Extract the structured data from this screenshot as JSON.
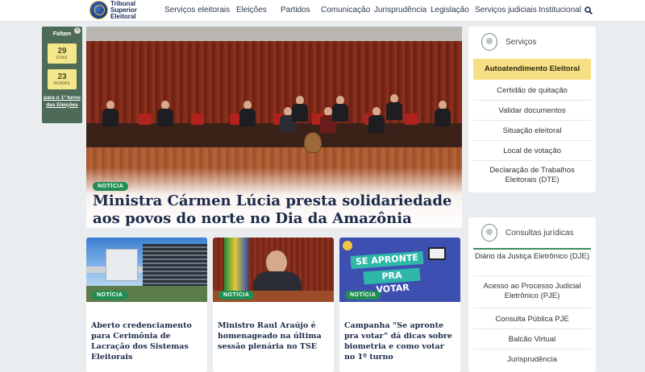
{
  "header": {
    "logo_lines": [
      "Tribunal",
      "Superior",
      "Eleitoral"
    ],
    "nav": [
      "Serviços eleitorais",
      "Eleições",
      "Partidos",
      "Comunicação",
      "Jurisprudência",
      "Legislação",
      "Serviços judiciais",
      "Institucional"
    ],
    "search_icon": "search-icon"
  },
  "countdown": {
    "close": "×",
    "title": "Faltam",
    "days_value": "29",
    "days_unit": "DIAS",
    "hours_value": "23",
    "hours_unit": "HORAS",
    "link": "para o 1º turno das Eleições"
  },
  "hero": {
    "tag": "NOTÍCIA",
    "headline": "Ministra Cármen Lúcia presta solidariedade aos povos do norte no Dia da Amazônia"
  },
  "cards": [
    {
      "tag": "NOTÍCIA",
      "title": "Aberto credenciamento para Cerimônia de Lacração dos Sistemas Eleitorais"
    },
    {
      "tag": "NOTÍCIA",
      "title": "Ministro Raul Araújo é homenageado na última sessão plenária no TSE"
    },
    {
      "tag": "NOTÍCIA",
      "title": "Campanha “Se apronte pra votar” dá dicas sobre biometria e como votar no 1º turno",
      "image_text_1": "SE APRONTE",
      "image_text_2": "PRA VOTAR"
    }
  ],
  "servicos": {
    "title": "Serviços",
    "items": [
      "Autoatendimento Eleitoral",
      "Certidão de quitação",
      "Validar documentos",
      "Situação eleitoral",
      "Local de votação",
      "Declaração de Trabalhos Eleitorais (DTE)"
    ]
  },
  "consultas": {
    "title": "Consultas jurídicas",
    "items": [
      "Diário da Justiça Eletrônico (DJE)",
      "Acesso ao Processo Judicial Eletrônico (PJE)",
      "Consulta Pública PJE",
      "Balcão Virtual",
      "Jurisprudência"
    ]
  },
  "colors": {
    "accent_green": "#1f8e53",
    "highlight_yellow": "#f7df86",
    "countdown_green": "#4d6b57"
  }
}
